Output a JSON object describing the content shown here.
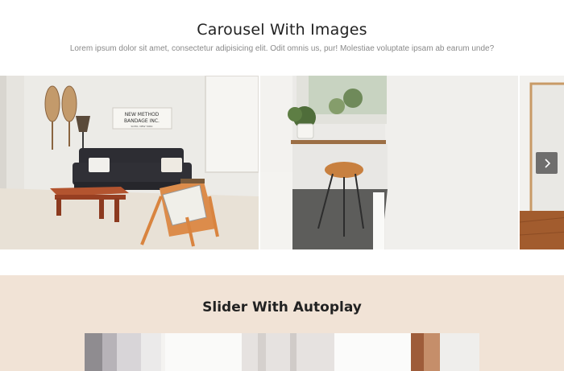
{
  "carousel": {
    "title": "Carousel With Images",
    "subtitle": "Lorem ipsum dolor sit amet, consectetur adipisicing elit. Odit omnis us, pur! Molestiae voluptate ipsam ab earum unde?",
    "slides": [
      {
        "description": "living room",
        "sign_line1": "NEW METHOD",
        "sign_line2": "BANDAGE INC.",
        "sign_line3": "SOHO, NEW YORK"
      },
      {
        "description": "hallway"
      },
      {
        "description": "mirror"
      }
    ],
    "next_icon": "chevron-right-icon"
  },
  "slider": {
    "title": "Slider With Autoplay"
  },
  "colors": {
    "slider_bg": "#f1e3d6",
    "arrow_bg": "#464646"
  }
}
